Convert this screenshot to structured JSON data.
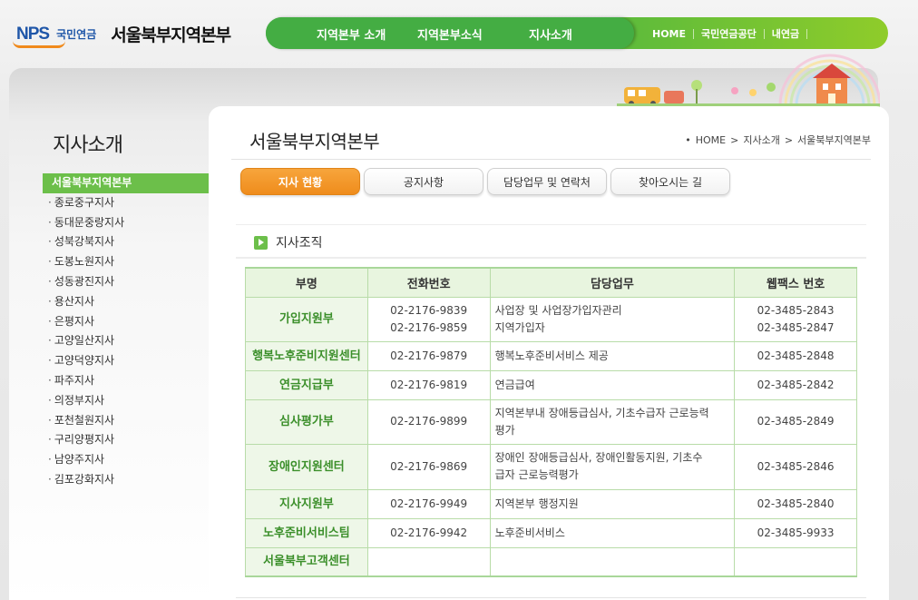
{
  "header": {
    "logo_text": "NPS",
    "logo_sub": "국민연금",
    "title": "서울북부지역본부",
    "gnb": [
      "지역본부 소개",
      "지역본부소식",
      "지사소개"
    ],
    "util": [
      "HOME",
      "국민연금공단",
      "내연금"
    ]
  },
  "sidebar": {
    "title": "지사소개",
    "items": [
      "서울북부지역본부",
      "종로중구지사",
      "동대문중랑지사",
      "성북강북지사",
      "도봉노원지사",
      "성동광진지사",
      "용산지사",
      "은평지사",
      "고양일산지사",
      "고양덕양지사",
      "파주지사",
      "의정부지사",
      "포천철원지사",
      "구리양평지사",
      "남양주지사",
      "김포강화지사"
    ]
  },
  "content": {
    "page_title": "서울북부지역본부",
    "breadcrumb": [
      "HOME",
      "지사소개",
      "서울북부지역본부"
    ],
    "tabs": [
      "지사 현황",
      "공지사항",
      "담당업무 및 연락처",
      "찾아오시는 길"
    ],
    "section_title": "지사조직",
    "table": {
      "headers": [
        "부명",
        "전화번호",
        "담당업무",
        "팩스 번호"
      ],
      "header_fax_prefix": "웹",
      "rows": [
        {
          "dept": "가입지원부",
          "phone1": "02-2176-9839",
          "phone2": "02-2176-9859",
          "duty1": "사업장 및 사업장가입자관리",
          "duty2": "지역가입자",
          "fax1": "02-3485-2843",
          "fax2": "02-3485-2847"
        },
        {
          "dept": "행복노후준비지원센터",
          "phone1": "02-2176-9879",
          "phone2": "",
          "duty1": "행복노후준비서비스 제공",
          "duty2": "",
          "fax1": "02-3485-2848",
          "fax2": ""
        },
        {
          "dept": "연금지급부",
          "phone1": "02-2176-9819",
          "phone2": "",
          "duty1": "연금급여",
          "duty2": "",
          "fax1": "02-3485-2842",
          "fax2": ""
        },
        {
          "dept": "심사평가부",
          "phone1": "02-2176-9899",
          "phone2": "",
          "duty1": "지역본부내 장애등급심사, 기초수급자 근로능력",
          "duty2": "평가",
          "fax1": "02-3485-2849",
          "fax2": ""
        },
        {
          "dept": "장애인지원센터",
          "phone1": "02-2176-9869",
          "phone2": "",
          "duty1": "장애인 장애등급심사, 장애인활동지원, 기초수",
          "duty2": "급자 근로능력평가",
          "fax1": "02-3485-2846",
          "fax2": ""
        },
        {
          "dept": "지사지원부",
          "phone1": "02-2176-9949",
          "phone2": "",
          "duty1": "지역본부 행정지원",
          "duty2": "",
          "fax1": "02-3485-2840",
          "fax2": ""
        },
        {
          "dept": "노후준비서비스팀",
          "phone1": "02-2176-9942",
          "phone2": "",
          "duty1": "노후준비서비스",
          "duty2": "",
          "fax1": "02-3485-9933",
          "fax2": ""
        },
        {
          "dept": "서울북부고객센터",
          "phone1": "",
          "phone2": "",
          "duty1": "",
          "duty2": "",
          "fax1": "",
          "fax2": ""
        }
      ]
    }
  },
  "colors": {
    "green": "#44ad43",
    "light_green": "#8fcc2a",
    "orange": "#ef8c1c",
    "dept_text": "#3b8f2a"
  }
}
